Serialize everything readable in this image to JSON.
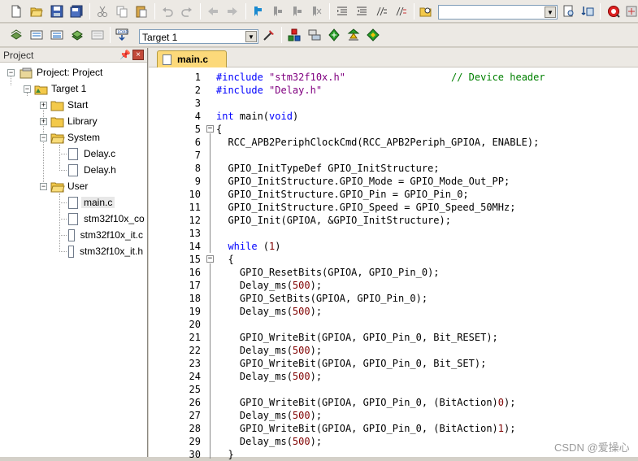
{
  "toolbar1": {
    "search_value": ""
  },
  "toolbar2": {
    "target_value": "Target 1"
  },
  "project_panel": {
    "title": "Project",
    "pin_glyph": "–",
    "close_glyph": "×",
    "tree": {
      "root": "Project: Project",
      "target": "Target 1",
      "groups": [
        {
          "label": "Start",
          "expanded": false
        },
        {
          "label": "Library",
          "expanded": false
        },
        {
          "label": "System",
          "expanded": true,
          "files": [
            "Delay.c",
            "Delay.h"
          ]
        },
        {
          "label": "User",
          "expanded": true,
          "files": [
            "main.c",
            "stm32f10x_co",
            "stm32f10x_it.c",
            "stm32f10x_it.h"
          ]
        }
      ]
    }
  },
  "editor": {
    "tab_label": "main.c",
    "line_numbers": [
      "1",
      "2",
      "3",
      "4",
      "5",
      "6",
      "7",
      "8",
      "9",
      "10",
      "11",
      "12",
      "13",
      "14",
      "15",
      "16",
      "17",
      "18",
      "19",
      "20",
      "21",
      "22",
      "23",
      "24",
      "25",
      "26",
      "27",
      "28",
      "29",
      "30"
    ],
    "lines": [
      [
        {
          "t": "#include ",
          "c": "kw"
        },
        {
          "t": "\"stm32f10x.h\"",
          "c": "str"
        },
        {
          "t": "                  ",
          "c": ""
        },
        {
          "t": "// Device header",
          "c": "cmt"
        }
      ],
      [
        {
          "t": "#include ",
          "c": "kw"
        },
        {
          "t": "\"Delay.h\"",
          "c": "str"
        }
      ],
      [],
      [
        {
          "t": "int",
          "c": "kw"
        },
        {
          "t": " main(",
          "c": ""
        },
        {
          "t": "void",
          "c": "kw"
        },
        {
          "t": ")",
          "c": ""
        }
      ],
      [
        {
          "t": "{",
          "c": ""
        }
      ],
      [
        {
          "t": "  RCC_APB2PeriphClockCmd(RCC_APB2Periph_GPIOA, ENABLE);",
          "c": ""
        }
      ],
      [],
      [
        {
          "t": "  GPIO_InitTypeDef GPIO_InitStructure;",
          "c": ""
        }
      ],
      [
        {
          "t": "  GPIO_InitStructure.GPIO_Mode = GPIO_Mode_Out_PP;",
          "c": ""
        }
      ],
      [
        {
          "t": "  GPIO_InitStructure.GPIO_Pin = GPIO_Pin_0;",
          "c": ""
        }
      ],
      [
        {
          "t": "  GPIO_InitStructure.GPIO_Speed = GPIO_Speed_50MHz;",
          "c": ""
        }
      ],
      [
        {
          "t": "  GPIO_Init(GPIOA, &GPIO_InitStructure);",
          "c": ""
        }
      ],
      [],
      [
        {
          "t": "  ",
          "c": ""
        },
        {
          "t": "while",
          "c": "kw"
        },
        {
          "t": " (",
          "c": ""
        },
        {
          "t": "1",
          "c": "num"
        },
        {
          "t": ")",
          "c": ""
        }
      ],
      [
        {
          "t": "  {",
          "c": ""
        }
      ],
      [
        {
          "t": "    GPIO_ResetBits(GPIOA, GPIO_Pin_0);",
          "c": ""
        }
      ],
      [
        {
          "t": "    Delay_ms(",
          "c": ""
        },
        {
          "t": "500",
          "c": "num"
        },
        {
          "t": ");",
          "c": ""
        }
      ],
      [
        {
          "t": "    GPIO_SetBits(GPIOA, GPIO_Pin_0);",
          "c": ""
        }
      ],
      [
        {
          "t": "    Delay_ms(",
          "c": ""
        },
        {
          "t": "500",
          "c": "num"
        },
        {
          "t": ");",
          "c": ""
        }
      ],
      [],
      [
        {
          "t": "    GPIO_WriteBit(GPIOA, GPIO_Pin_0, Bit_RESET);",
          "c": ""
        }
      ],
      [
        {
          "t": "    Delay_ms(",
          "c": ""
        },
        {
          "t": "500",
          "c": "num"
        },
        {
          "t": ");",
          "c": ""
        }
      ],
      [
        {
          "t": "    GPIO_WriteBit(GPIOA, GPIO_Pin_0, Bit_SET);",
          "c": ""
        }
      ],
      [
        {
          "t": "    Delay_ms(",
          "c": ""
        },
        {
          "t": "500",
          "c": "num"
        },
        {
          "t": ");",
          "c": ""
        }
      ],
      [],
      [
        {
          "t": "    GPIO_WriteBit(GPIOA, GPIO_Pin_0, (BitAction)",
          "c": ""
        },
        {
          "t": "0",
          "c": "num"
        },
        {
          "t": ");",
          "c": ""
        }
      ],
      [
        {
          "t": "    Delay_ms(",
          "c": ""
        },
        {
          "t": "500",
          "c": "num"
        },
        {
          "t": ");",
          "c": ""
        }
      ],
      [
        {
          "t": "    GPIO_WriteBit(GPIOA, GPIO_Pin_0, (BitAction)",
          "c": ""
        },
        {
          "t": "1",
          "c": "num"
        },
        {
          "t": ");",
          "c": ""
        }
      ],
      [
        {
          "t": "    Delay_ms(",
          "c": ""
        },
        {
          "t": "500",
          "c": "num"
        },
        {
          "t": ");",
          "c": ""
        }
      ],
      [
        {
          "t": "  }",
          "c": ""
        }
      ]
    ],
    "fold_markers": [
      "5",
      "15"
    ]
  },
  "watermark": "CSDN @爱操心"
}
